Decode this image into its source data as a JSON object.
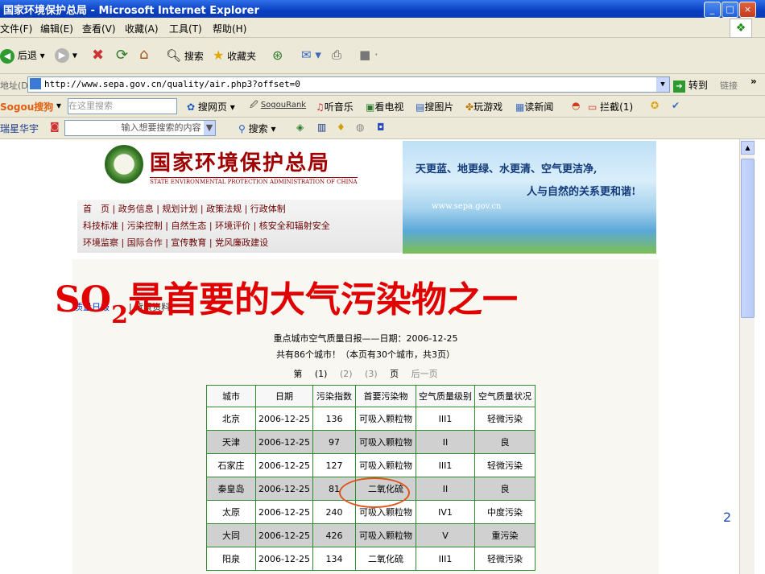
{
  "window": {
    "title": "国家环境保护总局 - Microsoft Internet Explorer",
    "buttons": {
      "minimize": "_",
      "maximize": "□",
      "close": "×"
    }
  },
  "menu": [
    "文件(F)",
    "编辑(E)",
    "查看(V)",
    "收藏(A)",
    "工具(T)",
    "帮助(H)"
  ],
  "toolbar": {
    "back": "后退",
    "search": "搜索",
    "favorites": "收藏夹"
  },
  "address": {
    "label": "地址(D)",
    "url": "http://www.sepa.gov.cn/quality/air.php3?offset=0",
    "go": "转到",
    "links": "链接"
  },
  "sogou": {
    "brand": "Sogou搜狗",
    "placeholder": "在这里搜索",
    "items": [
      "搜网页",
      "SogouRank",
      "听音乐",
      "看电视",
      "搜图片",
      "玩游戏",
      "读新闻",
      "拦截(1)"
    ]
  },
  "ctxbar": {
    "label": "瑞星华宇",
    "placeholder": "输入想要搜索的内容",
    "search": "搜索"
  },
  "site": {
    "org_name": "国家环境保护总局",
    "org_name_en": "STATE ENVIRONMENTAL PROTECTION ADMINISTRATION OF CHINA",
    "slogan1": "天更蓝、地更绿、水更清、空气更洁净,",
    "slogan2": "人与自然的关系更和谐!",
    "url": "www.sepa.gov.cn",
    "nav": [
      "首　页 | 政务信息 | 规划计划 | 政策法规 | 行政体制",
      "科技标准 | 污染控制 | 自然生态 | 环境评价 | 核安全和辐射安全",
      "环境监察 | 国际合作 | 宣传教育 | 党风廉政建设"
    ]
  },
  "slide": {
    "headline_pre": "SO",
    "headline_sub": "2",
    "headline_post": "是首要的大气污染物之一",
    "page_number": "2"
  },
  "crumbs": {
    "first": "质量日报",
    "sep": "|",
    "second": "背景资料"
  },
  "report": {
    "title": "重点城市空气质量日报——日期：2006-12-25",
    "summary": "共有86个城市！（本页有30个城市，共3页）",
    "pager": [
      "第",
      "(1)",
      "(2)",
      "(3)",
      "页",
      "后一页"
    ]
  },
  "table": {
    "headers": [
      "城市",
      "日期",
      "污染指数",
      "首要污染物",
      "空气质量级别",
      "空气质量状况"
    ],
    "rows": [
      [
        "北京",
        "2006-12-25",
        "136",
        "可吸入颗粒物",
        "III1",
        "轻微污染"
      ],
      [
        "天津",
        "2006-12-25",
        "97",
        "可吸入颗粒物",
        "II",
        "良"
      ],
      [
        "石家庄",
        "2006-12-25",
        "127",
        "可吸入颗粒物",
        "III1",
        "轻微污染"
      ],
      [
        "秦皇岛",
        "2006-12-25",
        "81",
        "二氧化硫",
        "II",
        "良"
      ],
      [
        "太原",
        "2006-12-25",
        "240",
        "可吸入颗粒物",
        "IV1",
        "中度污染"
      ],
      [
        "大同",
        "2006-12-25",
        "426",
        "可吸入颗粒物",
        "V",
        "重污染"
      ],
      [
        "阳泉",
        "2006-12-25",
        "134",
        "二氧化硫",
        "III1",
        "轻微污染"
      ]
    ]
  }
}
